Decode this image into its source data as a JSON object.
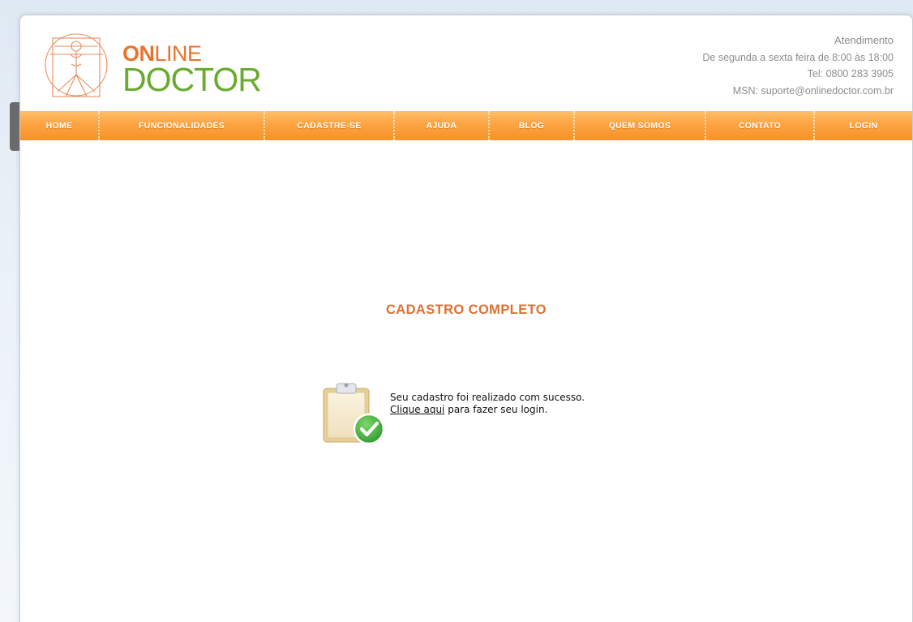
{
  "brand": {
    "on": "ON",
    "line": "LINE",
    "doctor": "DOCTOR"
  },
  "contact": {
    "title": "Atendimento",
    "hours": "De segunda a sexta feira de 8:00 às 18:00",
    "phone": "Tel: 0800 283 3905",
    "msn": "MSN: suporte@onlinedoctor.com.br"
  },
  "nav": {
    "items": [
      {
        "label": "HOME"
      },
      {
        "label": "FUNCIONALIDADES"
      },
      {
        "label": "CADASTRE-SE"
      },
      {
        "label": "AJUDA"
      },
      {
        "label": "BLOG"
      },
      {
        "label": "QUEM SOMOS"
      },
      {
        "label": "CONTATO"
      },
      {
        "label": "LOGIN"
      }
    ]
  },
  "main": {
    "heading": "CADASTRO COMPLETO",
    "message_line1": "Seu cadastro foi realizado com sucesso.",
    "link_text": "Clique aqui",
    "message_line2_rest": " para fazer seu login."
  },
  "colors": {
    "accent_orange": "#e8742c",
    "brand_green": "#68ab2e",
    "nav_orange": "#fda442",
    "success_green": "#4db84a"
  },
  "icons": {
    "logo": "vitruvian-man-icon",
    "success": "clipboard-check-icon"
  }
}
